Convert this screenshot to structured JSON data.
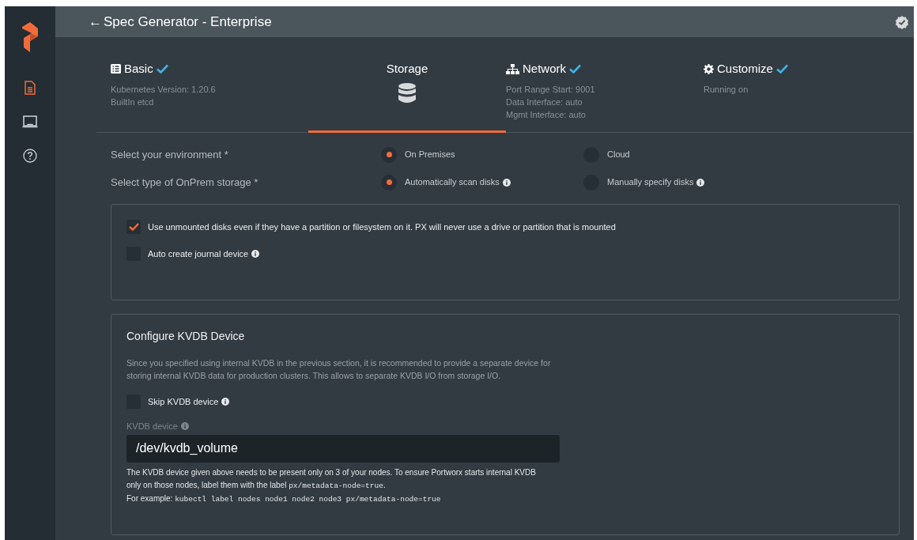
{
  "sidebar": {
    "items": [
      {
        "selected": true
      },
      {
        "selected": false
      },
      {
        "selected": false
      }
    ]
  },
  "header": {
    "back": "←",
    "title": "Spec Generator - Enterprise"
  },
  "steps": [
    {
      "title": "Basic",
      "done": true,
      "selected": false,
      "details": [
        "Kubernetes Version: 1.20.6",
        "BuiltIn etcd"
      ]
    },
    {
      "title": "Storage",
      "done": false,
      "selected": true
    },
    {
      "title": "Network",
      "done": true,
      "selected": false,
      "details": [
        "Port Range Start: 9001",
        "Data Interface: auto",
        "Mgmt Interface: auto"
      ]
    },
    {
      "title": "Customize",
      "done": true,
      "selected": false,
      "details": [
        "Running on"
      ]
    }
  ],
  "radio_groups": [
    {
      "label": "Select your environment *",
      "options": [
        {
          "label": "On Premises",
          "selected": true,
          "info": false
        },
        {
          "label": "Cloud",
          "selected": false,
          "info": false
        }
      ]
    },
    {
      "label": "Select type of OnPrem storage *",
      "options": [
        {
          "label": "Automatically scan disks",
          "selected": true,
          "info": true
        },
        {
          "label": "Manually specify disks",
          "selected": false,
          "info": true
        }
      ]
    }
  ],
  "disk_options": [
    {
      "label": "Use unmounted disks even if they have a partition or filesystem on it. PX will never use a drive or partition that is mounted",
      "checked": true,
      "info": false
    },
    {
      "label": "Auto create journal device",
      "checked": false,
      "info": true
    }
  ],
  "kvdb": {
    "title": "Configure KVDB Device",
    "description": "Since you specified using internal KVDB in the previous section, it is recommended to provide a separate device for storing internal KVDB data for production clusters. This allows to separate KVDB I/O from storage I/O.",
    "skip": {
      "label": "Skip KVDB device",
      "checked": false,
      "info": true
    },
    "device_label": "KVDB device",
    "device_value": "/dev/kvdb_volume",
    "help": [
      [
        {
          "kind": "text",
          "text": "The KVDB device given above needs to be present only on 3 of your nodes. To ensure Portworx starts internal KVDB only on those nodes, label them with the label "
        },
        {
          "kind": "code",
          "text": "px/metadata-node=true"
        },
        {
          "kind": "text",
          "text": "."
        }
      ],
      [
        {
          "kind": "text",
          "text": "For example: "
        },
        {
          "kind": "code",
          "text": "kubectl label nodes node1 node2 node3 px/metadata-node=true"
        }
      ]
    ]
  }
}
